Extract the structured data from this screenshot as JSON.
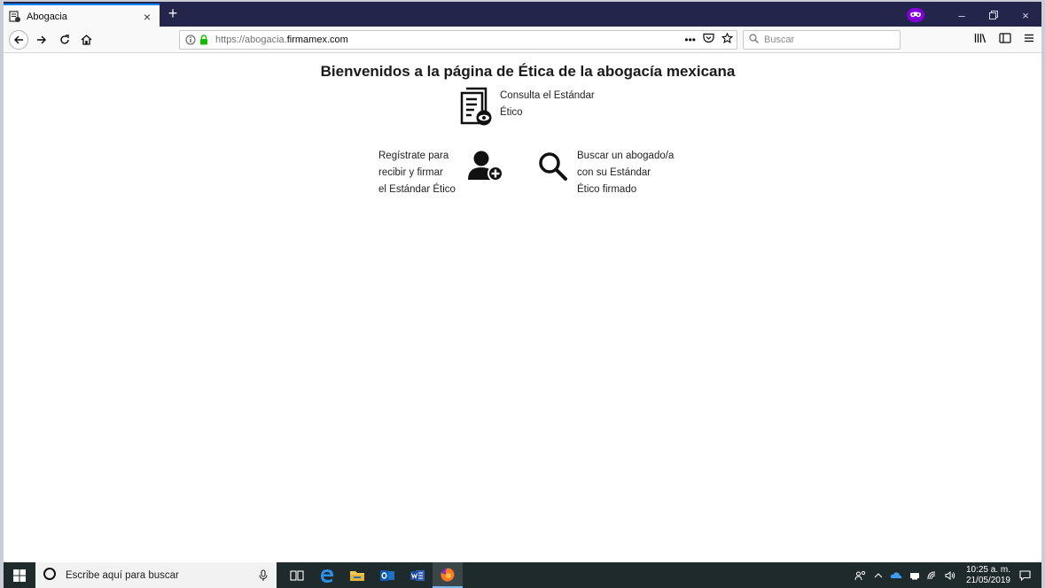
{
  "browser": {
    "tab_title": "Abogacia",
    "tab_close": "×",
    "new_tab": "+",
    "url_prefix": "https://abogacia.",
    "url_domain": "firmamex.com",
    "page_actions": "•••",
    "search_placeholder": "Buscar",
    "window_controls": {
      "minimize": "–",
      "maximize": "🗗",
      "close": "×"
    }
  },
  "page": {
    "heading": "Bienvenidos a la página de Ética de la abogacía mexicana",
    "consulta": {
      "line1": "Consulta el Estándar",
      "line2": "Ético"
    },
    "registro": {
      "line1": "Regístrate para",
      "line2": "recibir y firmar",
      "line3": "el Estándar Ético"
    },
    "buscar": {
      "line1": "Buscar un abogado/a",
      "line2": "con su Estándar",
      "line3": "Ético firmado"
    }
  },
  "taskbar": {
    "search_placeholder": "Escribe aquí para buscar",
    "time": "10:25 a. m.",
    "date": "21/05/2019"
  },
  "colors": {
    "tabbar_bg": "#23254a",
    "accent": "#0a84ff",
    "private_mask": "#8000d7",
    "lock_green": "#12bc00",
    "taskbar_bg": "#1f2a2c"
  }
}
